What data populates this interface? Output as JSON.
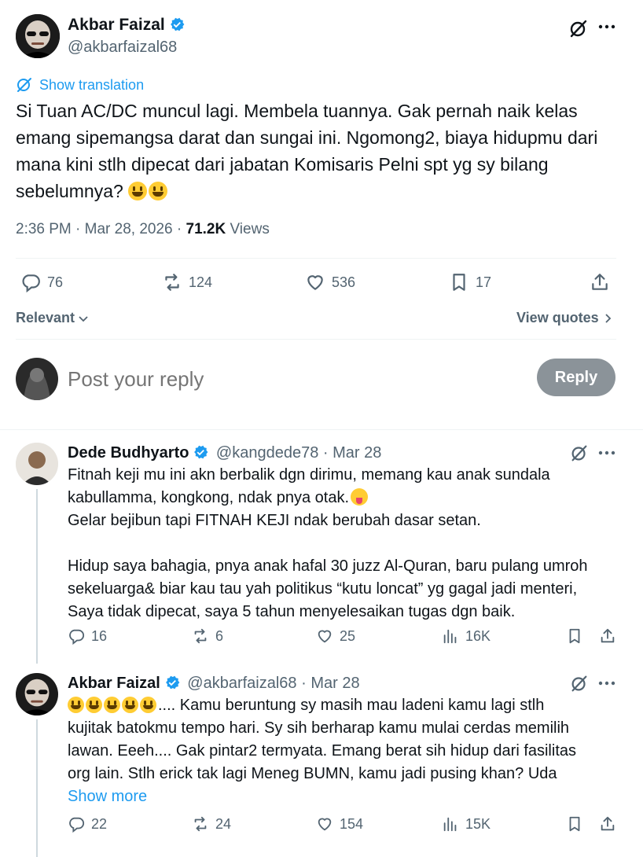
{
  "main_post": {
    "author_name": "Akbar Faizal",
    "author_handle": "@akbarfaizal68",
    "show_translation": "Show translation",
    "text": "Si Tuan AC/DC muncul lagi. Membela tuannya.  Gak pernah naik kelas emang sipemangsa darat dan sungai ini. Ngomong2, biaya hidupmu dari mana kini stlh dipecat dari jabatan Komisaris Pelni spt yg sy bilang sebelumnya?",
    "timestamp": "2:36 PM · Mar 28, 2026 · ",
    "views_count": "71.2K",
    "views_label": " Views",
    "stats": {
      "replies": "76",
      "reposts": "124",
      "likes": "536",
      "bookmarks": "17"
    }
  },
  "sort": {
    "label": "Relevant",
    "view_quotes": "View quotes"
  },
  "composer": {
    "placeholder": "Post your reply",
    "button": "Reply"
  },
  "replies": [
    {
      "author_name": "Dede Budhyarto",
      "author_handle": "@kangdede78",
      "date": " · Mar 28",
      "lines": [
        "Fitnah keji mu ini akn berbalik dgn dirimu, memang kau anak sundala",
        "kabullamma, kongkong, ndak pnya otak.",
        "Gelar bejibun tapi FITNAH KEJI ndak berubah dasar setan.",
        "",
        "Hidup saya bahagia, pnya anak hafal 30 juzz Al-Quran, baru pulang umroh",
        "sekeluarga& biar kau tau yah politikus “kutu loncat” yg gagal jadi menteri,",
        "Saya tidak dipecat, saya 5 tahun menyelesaikan tugas dgn baik."
      ],
      "stats": {
        "replies": "16",
        "reposts": "6",
        "likes": "25",
        "views": "16K"
      }
    },
    {
      "author_name": "Akbar Faizal",
      "author_handle": "@akbarfaizal68",
      "date": " · Mar 28",
      "lines": [
        "....  Kamu beruntung sy masih mau ladeni kamu lagi stlh",
        "kujitak batokmu tempo hari. Sy sih berharap kamu mulai cerdas memilih",
        "lawan. Eeeh.... Gak pintar2 termyata. Emang berat sih hidup dari fasilitas",
        "org lain. Stlh erick tak lagi Meneg BUMN, kamu jadi pusing khan? Uda"
      ],
      "show_more": "Show more",
      "stats": {
        "replies": "22",
        "reposts": "24",
        "likes": "154",
        "views": "15K"
      }
    }
  ],
  "colors": {
    "accent": "#1d9bf0",
    "muted": "#536471",
    "text": "#0f1419",
    "verified": "#1d9bf0",
    "reply_button": "#8b9399"
  }
}
